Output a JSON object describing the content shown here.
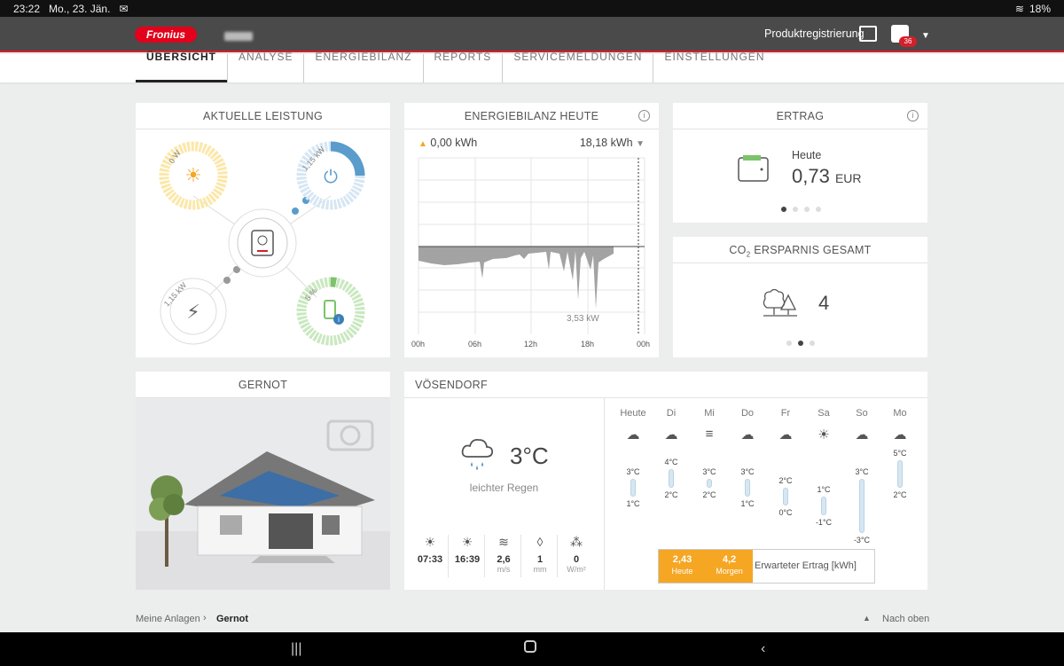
{
  "statusbar": {
    "time": "23:22",
    "date": "Mo., 23. Jän.",
    "battery": "18%"
  },
  "header": {
    "logo_text": "Fronius",
    "product_registration": "Produktregistrierung",
    "notification_count": "36"
  },
  "nav": {
    "tabs": [
      "ÜBERSICHT",
      "ANALYSE",
      "ENERGIEBILANZ",
      "REPORTS",
      "SERVICEMELDUNGEN",
      "EINSTELLUNGEN"
    ]
  },
  "power": {
    "title": "AKTUELLE LEISTUNG",
    "pv_value": "0 W",
    "load_value": "1,15 kW",
    "grid_value": "1,15 kW",
    "battery_value": "5 %"
  },
  "energy_balance": {
    "title": "ENERGIEBILANZ HEUTE",
    "produced": "0,00 kWh",
    "consumed": "18,18 kWh",
    "peak_label": "3,53 kW",
    "xticks": [
      "00h",
      "06h",
      "12h",
      "18h",
      "00h"
    ]
  },
  "yield": {
    "title": "ERTRAG",
    "label": "Heute",
    "value": "0,73",
    "unit": "EUR"
  },
  "co2": {
    "title_prefix": "CO",
    "title_sub": "2",
    "title_suffix": " ERSPARNIS GESAMT",
    "value": "4"
  },
  "system": {
    "title": "GERNOT"
  },
  "weather": {
    "title": "VÖSENDORF",
    "current_temp": "3°C",
    "current_desc": "leichter Regen",
    "stats": [
      {
        "icon": "sunrise-icon",
        "value": "07:33",
        "unit": ""
      },
      {
        "icon": "sunset-icon",
        "value": "16:39",
        "unit": ""
      },
      {
        "icon": "wind-icon",
        "value": "2,6",
        "unit": "m/s"
      },
      {
        "icon": "rain-icon",
        "value": "1",
        "unit": "mm"
      },
      {
        "icon": "irradiance-icon",
        "value": "0",
        "unit": "W/m²"
      }
    ],
    "days": [
      {
        "name": "Heute",
        "max": "3°C",
        "min": "1°C"
      },
      {
        "name": "Di",
        "max": "4°C",
        "min": "2°C"
      },
      {
        "name": "Mi",
        "max": "3°C",
        "min": "2°C"
      },
      {
        "name": "Do",
        "max": "3°C",
        "min": "1°C"
      },
      {
        "name": "Fr",
        "max": "2°C",
        "min": "0°C"
      },
      {
        "name": "Sa",
        "max": "1°C",
        "min": "-1°C"
      },
      {
        "name": "So",
        "max": "3°C",
        "min": "-3°C"
      },
      {
        "name": "Mo",
        "max": "5°C",
        "min": "2°C"
      }
    ],
    "expected_today": "2,43",
    "expected_today_label": "Heute",
    "expected_tomorrow": "4,2",
    "expected_tomorrow_label": "Morgen",
    "expected_label": "Erwarteter Ertrag [kWh]"
  },
  "footer": {
    "breadcrumb_root": "Meine Anlagen",
    "breadcrumb_current": "Gernot",
    "back_to_top": "Nach oben"
  },
  "colors": {
    "accent_red": "#d3202b",
    "solar_yellow": "#f5a623",
    "load_blue": "#5a9ccb",
    "battery_green": "#7cc36b"
  }
}
